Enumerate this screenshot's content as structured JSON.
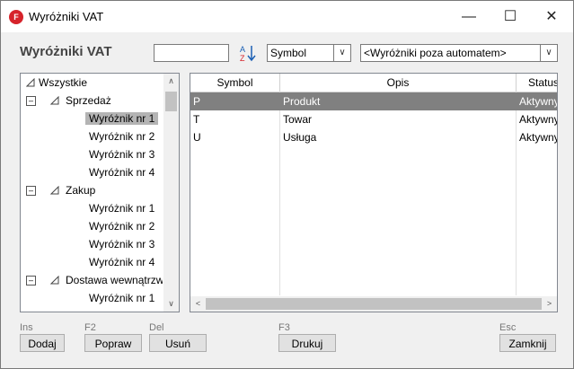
{
  "window": {
    "title": "Wyróżniki VAT",
    "icon_letter": "F"
  },
  "header": {
    "heading": "Wyróżniki VAT",
    "search_value": "",
    "sort_field": "Symbol",
    "filter": "<Wyróżniki poza automatem>"
  },
  "tree": {
    "root": "Wszystkie",
    "items": [
      {
        "label": "Sprzedaż"
      },
      {
        "label": "Wyróżnik nr 1"
      },
      {
        "label": "Wyróżnik nr 2"
      },
      {
        "label": "Wyróżnik nr 3"
      },
      {
        "label": "Wyróżnik nr 4"
      },
      {
        "label": "Zakup"
      },
      {
        "label": "Wyróżnik nr 1"
      },
      {
        "label": "Wyróżnik nr 2"
      },
      {
        "label": "Wyróżnik nr 3"
      },
      {
        "label": "Wyróżnik nr 4"
      },
      {
        "label": "Dostawa wewnątrzwsp"
      },
      {
        "label": "Wyróżnik nr 1"
      }
    ]
  },
  "grid": {
    "columns": [
      "Symbol",
      "Opis",
      "Status"
    ],
    "rows": [
      {
        "symbol": "P",
        "opis": "Produkt",
        "status": "Aktywny"
      },
      {
        "symbol": "T",
        "opis": "Towar",
        "status": "Aktywny"
      },
      {
        "symbol": "U",
        "opis": "Usługa",
        "status": "Aktywny"
      }
    ]
  },
  "buttons": {
    "add": {
      "hint": "Ins",
      "label": "Dodaj"
    },
    "edit": {
      "hint": "F2",
      "label": "Popraw"
    },
    "delete": {
      "hint": "Del",
      "label": "Usuń"
    },
    "print": {
      "hint": "F3",
      "label": "Drukuj"
    },
    "close": {
      "hint": "Esc",
      "label": "Zamknij"
    }
  },
  "colors": {
    "accent": "#d6232b",
    "selection_grid": "#808080",
    "selection_tree": "#b4b4b4"
  }
}
